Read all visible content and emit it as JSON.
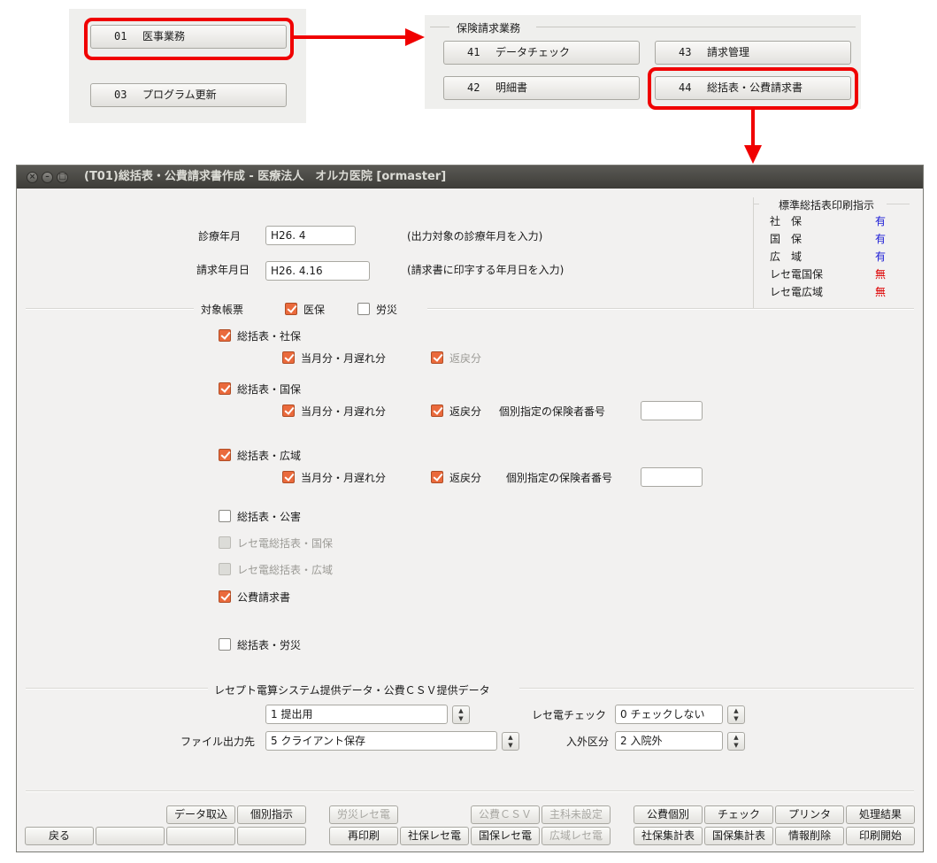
{
  "menu1": {
    "buttons": [
      {
        "num": "01",
        "label": "医事業務"
      },
      {
        "num": "03",
        "label": "プログラム更新"
      }
    ]
  },
  "menu2": {
    "group_title": "保険請求業務",
    "buttons": [
      {
        "num": "41",
        "label": "データチェック"
      },
      {
        "num": "43",
        "label": "請求管理"
      },
      {
        "num": "42",
        "label": "明細書"
      },
      {
        "num": "44",
        "label": "総括表・公費請求書"
      }
    ]
  },
  "colors": {
    "highlight": "#f00000",
    "checkbox": "#ea6a3c",
    "yes": "#1a1ad6",
    "no": "#dd0000"
  },
  "window": {
    "title": "(T01)総括表・公費請求書作成 - 医療法人　オルカ医院  [ormaster]",
    "controls": [
      "close-icon",
      "minimize-icon",
      "maximize-icon"
    ]
  },
  "form": {
    "shinryo_label": "診療年月",
    "shinryo_value": "H26. 4",
    "shinryo_hint": "(出力対象の診療年月を入力)",
    "seikyu_label": "請求年月日",
    "seikyu_value": "H26. 4.16",
    "seikyu_hint": "(請求書に印字する年月日を入力)"
  },
  "standard_panel": {
    "title": "標準総括表印刷指示",
    "rows": [
      {
        "label": "社　保",
        "value": "有"
      },
      {
        "label": "国　保",
        "value": "有"
      },
      {
        "label": "広　域",
        "value": "有"
      },
      {
        "label": "レセ電国保",
        "value": "無"
      },
      {
        "label": "レセ電広域",
        "value": "無"
      }
    ]
  },
  "target": {
    "label": "対象帳票",
    "iho": {
      "label": "医保",
      "checked": true
    },
    "rosai": {
      "label": "労災",
      "checked": false
    }
  },
  "sections": {
    "shaho": {
      "label": "総括表・社保",
      "checked": true,
      "sub1": "当月分・月遅れ分",
      "sub2": "返戻分",
      "sub2_disabled": true
    },
    "kokuho": {
      "label": "総括表・国保",
      "checked": true,
      "sub1": "当月分・月遅れ分",
      "sub2": "返戻分",
      "insurer_label": "個別指定の保険者番号",
      "insurer_value": ""
    },
    "koiki": {
      "label": "総括表・広域",
      "checked": true,
      "sub1": "当月分・月遅れ分",
      "sub2": "返戻分",
      "insurer_label": "個別指定の保険者番号",
      "insurer_value": ""
    },
    "kogai": {
      "label": "総括表・公害",
      "checked": false
    },
    "rece_kokuho": {
      "label": "レセ電総括表・国保",
      "checked": false,
      "disabled": true
    },
    "rece_koiki": {
      "label": "レセ電総括表・広域",
      "checked": false,
      "disabled": true
    },
    "kohi": {
      "label": "公費請求書",
      "checked": true
    },
    "rosai": {
      "label": "総括表・労災",
      "checked": false
    }
  },
  "csv": {
    "title": "レセプト電算システム提供データ・公費ＣＳＶ提供データ",
    "submit_value": "1 提出用",
    "file_label": "ファイル出力先",
    "file_value": "5 クライアント保存",
    "rece_check_label": "レセ電チェック",
    "rece_check_value": "0 チェックしない",
    "nyugai_label": "入外区分",
    "nyugai_value": "2 入院外"
  },
  "buttons": {
    "back": "戻る",
    "data_import": "データ取込",
    "individual": "個別指示",
    "rosai_rece": "労災レセ電",
    "reprint": "再印刷",
    "shaho_rece": "社保レセ電",
    "kohi_csv": "公費ＣＳＶ",
    "kokuho_rece": "国保レセ電",
    "shuka_setting": "主科未設定",
    "koiki_rece": "広域レセ電",
    "kohi_kobetsu": "公費個別",
    "shaho_total": "社保集計表",
    "check": "チェック",
    "kokuho_total": "国保集計表",
    "printer": "プリンタ",
    "info_delete": "情報削除",
    "result": "処理結果",
    "print_start": "印刷開始"
  }
}
